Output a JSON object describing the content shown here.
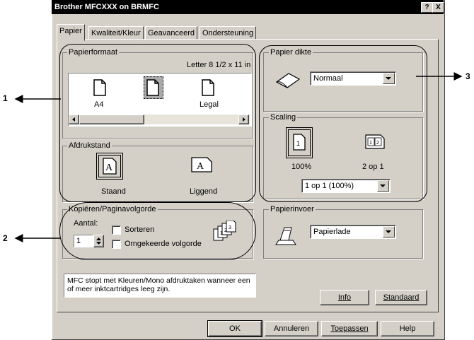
{
  "window": {
    "title": "Brother MFCXXX on BRMFC",
    "help_btn": "?",
    "close_btn": "X"
  },
  "tabs": [
    "Papier",
    "Kwaliteit/Kleur",
    "Geavanceerd",
    "Ondersteuning"
  ],
  "paper_size": {
    "label": "Papierformaat",
    "current": "Letter 8 1/2 x 11 in",
    "items": [
      "A4",
      "Letter",
      "Legal"
    ],
    "selected": "Letter"
  },
  "orientation": {
    "label": "Afdrukstand",
    "portrait": "Staand",
    "landscape": "Liggend"
  },
  "copies": {
    "label": "Kopiëren/Paginavolgorde",
    "count_label": "Aantal:",
    "count": "1",
    "collate": "Sorteren",
    "reverse": "Omgekeerde volgorde"
  },
  "paper_thickness": {
    "label": "Papier dikte",
    "value": "Normaal"
  },
  "scaling": {
    "label": "Scaling",
    "opt1": "100%",
    "opt2": "2 op 1",
    "value": "1 op 1 (100%)"
  },
  "paper_source": {
    "label": "Papierinvoer",
    "value": "Papierlade"
  },
  "info_text": "MFC stopt met Kleuren/Mono afdruktaken wanneer een of meer inktcartridges leeg zijn.",
  "buttons": {
    "info": "Info",
    "default": "Standaard",
    "ok": "OK",
    "cancel": "Annuleren",
    "apply": "Toepassen",
    "help": "Help"
  },
  "callouts": [
    "1",
    "2",
    "3"
  ]
}
